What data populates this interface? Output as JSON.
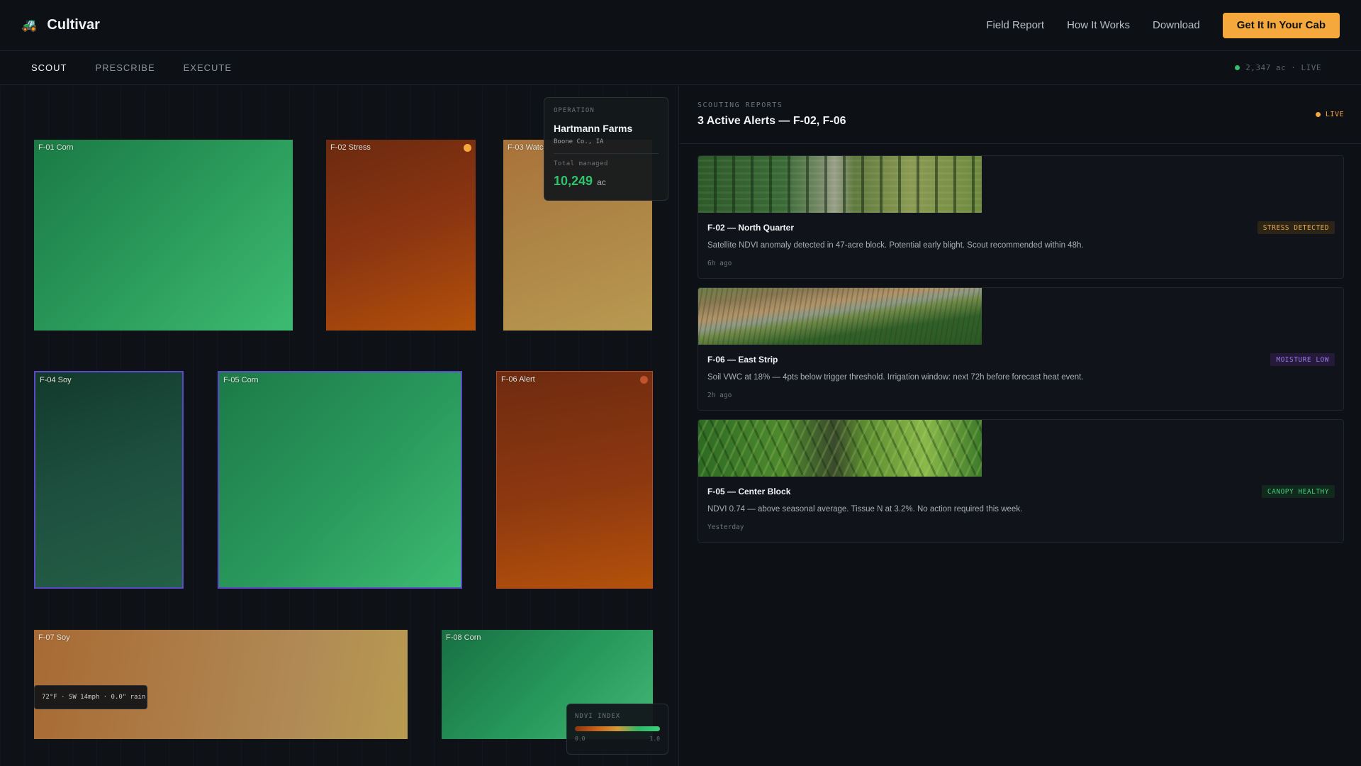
{
  "header": {
    "brand": "Cultivar",
    "logo_icon": "🚜",
    "nav": [
      "Field Report",
      "How It Works",
      "Download"
    ],
    "cta": "Get It In Your Cab"
  },
  "subnav": {
    "tabs": [
      "SCOUT",
      "PRESCRIBE",
      "EXECUTE"
    ],
    "active": "SCOUT",
    "status": "2,347 ac · LIVE"
  },
  "map": {
    "fields": [
      {
        "label": "F-01 Corn"
      },
      {
        "label": "F-02 Stress",
        "marker_color": "#f5a93c"
      },
      {
        "label": "F-03 Watch"
      },
      {
        "label": "F-04 Soy"
      },
      {
        "label": "F-05 Corn"
      },
      {
        "label": "F-06 Alert",
        "marker_color": "#c0522e"
      },
      {
        "label": "F-07 Soy"
      },
      {
        "label": "F-08 Corn"
      }
    ],
    "operation": {
      "label": "OPERATION",
      "farm": "Hartmann Farms",
      "county": "Boone Co., IA",
      "total_label": "Total managed",
      "acres": "10,249",
      "unit": "ac"
    },
    "weather": "72°F · SW 14mph · 0.0\" rain",
    "ndvi": {
      "label": "NDVI INDEX",
      "min": "0.0",
      "max": "1.0"
    }
  },
  "panel": {
    "kicker": "SCOUTING REPORTS",
    "title": "3 Active Alerts — F-02, F-06",
    "live": "LIVE",
    "reports": [
      {
        "title": "F-02 — North Quarter",
        "badge": "STRESS DETECTED",
        "desc": "Satellite NDVI anomaly detected in 47-acre block. Potential early blight. Scout recommended within 48h.",
        "time": "6h ago"
      },
      {
        "title": "F-06 — East Strip",
        "badge": "MOISTURE LOW",
        "desc": "Soil VWC at 18% — 4pts below trigger threshold. Irrigation window: next 72h before forecast heat event.",
        "time": "2h ago"
      },
      {
        "title": "F-05 — Center Block",
        "badge": "CANOPY HEALTHY",
        "desc": "NDVI 0.74 — above seasonal average. Tissue N at 3.2%. No action required this week.",
        "time": "Yesterday"
      }
    ]
  },
  "colors": {
    "accent": "#f5a93c",
    "live_green": "#2fc46b",
    "background": "#0d1014"
  }
}
